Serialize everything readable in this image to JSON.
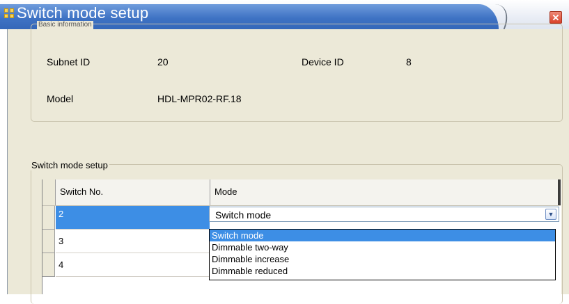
{
  "window": {
    "title": "Switch mode setup",
    "close_glyph": "✕"
  },
  "basic_info": {
    "legend": "Basic information",
    "subnet_label": "Subnet ID",
    "subnet_value": "20",
    "device_label": "Device ID",
    "device_value": "8",
    "model_label": "Model",
    "model_value": "HDL-MPR02-RF.18"
  },
  "switch_setup": {
    "legend": "Switch mode setup",
    "columns": [
      "Switch No.",
      "Mode"
    ],
    "rows": [
      {
        "switch_no": "2",
        "mode": "Switch mode",
        "selected": true
      },
      {
        "switch_no": "3"
      },
      {
        "switch_no": "4"
      }
    ],
    "combo_value": "Switch mode",
    "dropdown_options": [
      "Switch mode",
      "Dimmable two-way",
      "Dimmable increase",
      "Dimmable reduced"
    ],
    "dropdown_highlighted": "Switch mode"
  },
  "colors": {
    "title_bar": "#3f73c4",
    "selection": "#3d8ee5",
    "dialog_bg": "#ece9d8",
    "close_button": "#d9412a"
  }
}
